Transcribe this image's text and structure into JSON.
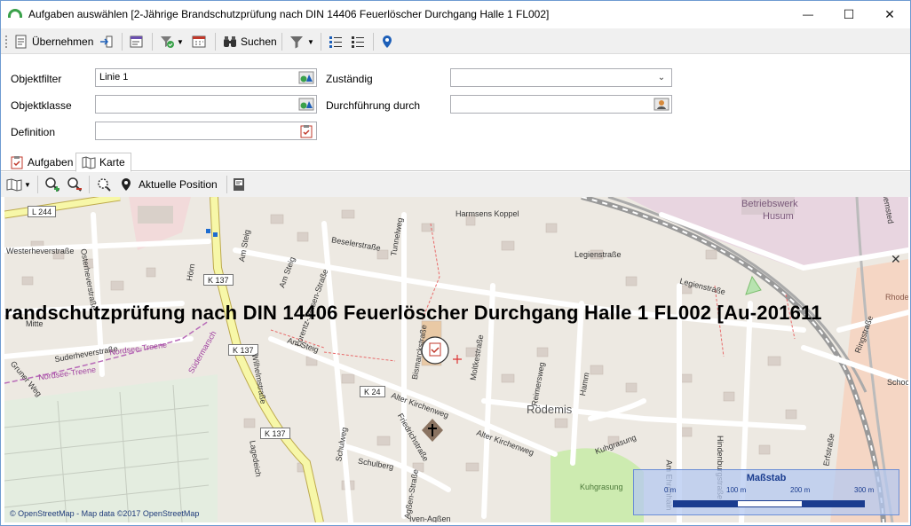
{
  "window": {
    "title": "Aufgaben auswählen [2-Jährige Brandschutzprüfung nach DIN 14406 Feuerlöscher Durchgang Halle 1 FL002]",
    "minimize": "—",
    "maximize": "☐",
    "close": "✕"
  },
  "toolbar": {
    "uebernehmen": "Übernehmen",
    "suchen": "Suchen"
  },
  "form": {
    "objektfilter_label": "Objektfilter",
    "objektfilter_value": "Linie 1",
    "objektklasse_label": "Objektklasse",
    "objektklasse_value": "",
    "definition_label": "Definition",
    "definition_value": "",
    "zustaendig_label": "Zuständig",
    "zustaendig_value": "",
    "durchfuehrung_label": "Durchführung durch",
    "durchfuehrung_value": ""
  },
  "tabs": [
    {
      "label": "Aufgaben"
    },
    {
      "label": "Karte"
    }
  ],
  "map_toolbar": {
    "aktuelle_position": "Aktuelle Position"
  },
  "map": {
    "banner": "randschutzprüfung nach DIN 14406 Feuerlöscher Durchgang Halle 1 FL002 [Au-201611",
    "labels": [
      "L 244",
      "K 137",
      "K 137",
      "K 24",
      "K 137",
      "Harmsens Koppel",
      "Beselerstraße",
      "Legienstraße",
      "Legienstraße",
      "Tunnelweg",
      "Am Steig",
      "Am Steig",
      "Lorentz-Jensen-Straße",
      "Bismarckstraße",
      "Moltkestraße",
      "Reimersweg",
      "Hamm",
      "Rödemis",
      "Alter Kirchenweg",
      "Alter Kirchenweg",
      "Friedrichstraße",
      "Schulweg",
      "Schulberg",
      "Kuhgrasung",
      "Kuhgrasung",
      "Wilhelmstraße",
      "Suderheverstraße",
      "Osterheverstraße",
      "Westerheverstraße",
      "Nordsee-Treene",
      "Nordsee-Treene",
      "Südermarsch",
      "Gruner Weg",
      "Betriebswerk",
      "Husum",
      "Ringstraße",
      "Erfstraße",
      "Rhode",
      "Schoo",
      "Lagedeich",
      "Iven-Agßen",
      "Agßen-Straße",
      "Hindenburgstraße",
      "Am Ehrenhain",
      "Hörn",
      "Am Steig",
      "Mitte",
      "demsted"
    ],
    "scale_title": "Maßstab",
    "scale_ticks": [
      "0 m",
      "100 m",
      "200 m",
      "300 m"
    ],
    "attribution": "© OpenStreetMap - Map data ©2017 OpenStreetMap",
    "close": "✕"
  },
  "colors": {
    "accent": "#3aa14a",
    "toolbar_bg": "#f0f0f0",
    "map_bg": "#ede9e2",
    "road_yellow": "#f7f7a8",
    "scale_bar": "#1a3c8f"
  }
}
